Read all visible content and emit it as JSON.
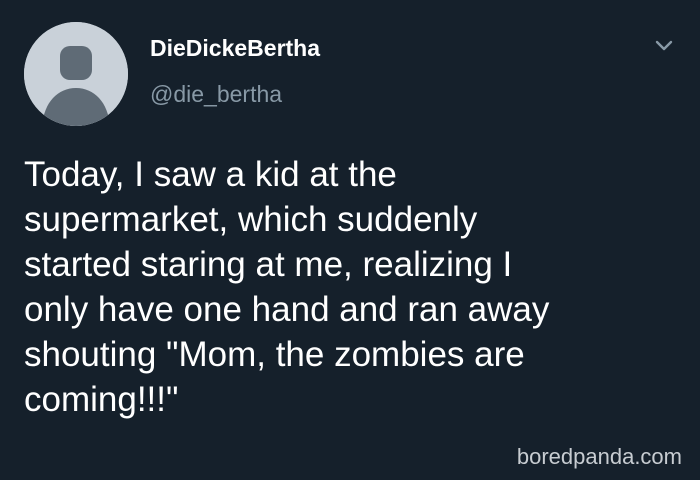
{
  "tweet": {
    "display_name": "DieDickeBertha",
    "handle": "@die_bertha",
    "text": "Today, I saw a kid at the\nsupermarket, which suddenly\nstarted staring at me, realizing I\nonly have one hand and ran away\nshouting \"Mom, the zombies are\ncoming!!!\"",
    "avatar_icon": "default-avatar-icon",
    "menu_icon": "chevron-down-icon"
  },
  "watermark": {
    "text": "boredpanda.com"
  },
  "colors": {
    "background": "#15202b",
    "primary_text": "#ffffff",
    "secondary_text": "#8899a6",
    "avatar_background": "#c9d1d9",
    "avatar_figure": "#5f6b76",
    "watermark_text": "#c7ccd1"
  }
}
